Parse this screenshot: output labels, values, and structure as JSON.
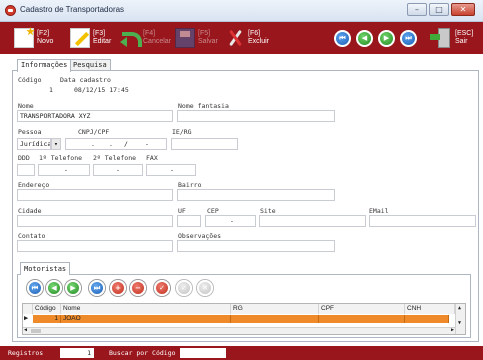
{
  "window": {
    "title": "Cadastro de Transportadoras"
  },
  "toolbar": {
    "novo": {
      "key": "[F2]",
      "label": "Novo"
    },
    "editar": {
      "key": "[F3]",
      "label": "Editar"
    },
    "cancelar": {
      "key": "[F4]",
      "label": "Cancelar"
    },
    "salvar": {
      "key": "[F5]",
      "label": "Salvar"
    },
    "excluir": {
      "key": "[F6]",
      "label": "Excluir"
    },
    "sair": {
      "key": "[ESC]",
      "label": "Sair"
    }
  },
  "tabs": [
    "Informações",
    "Pesquisa"
  ],
  "form": {
    "codigo": {
      "label": "Código",
      "value": "1"
    },
    "data_cadastro": {
      "label": "Data cadastro",
      "value": "08/12/15 17:45"
    },
    "nome": {
      "label": "Nome",
      "value": "TRANSPORTADORA XYZ"
    },
    "nome_fantasia": {
      "label": "Nome fantasia",
      "value": ""
    },
    "pessoa": {
      "label": "Pessoa",
      "value": "Jurídica"
    },
    "cnpj_cpf": {
      "label": "CNPJ/CPF",
      "value": ""
    },
    "ie_rg": {
      "label": "IE/RG",
      "value": ""
    },
    "ddd": {
      "label": "DDD",
      "value": ""
    },
    "telefone1": {
      "label": "1º Telefone",
      "value": ""
    },
    "telefone2": {
      "label": "2º Telefone",
      "value": ""
    },
    "fax": {
      "label": "FAX",
      "value": ""
    },
    "endereco": {
      "label": "Endereço",
      "value": ""
    },
    "bairro": {
      "label": "Bairro",
      "value": ""
    },
    "cidade": {
      "label": "Cidade",
      "value": ""
    },
    "uf": {
      "label": "UF",
      "value": ""
    },
    "cep": {
      "label": "CEP",
      "value": ""
    },
    "site": {
      "label": "Site",
      "value": ""
    },
    "email": {
      "label": "EMail",
      "value": ""
    },
    "contato": {
      "label": "Contato",
      "value": ""
    },
    "observacoes": {
      "label": "Observações",
      "value": ""
    }
  },
  "motoristas": {
    "title": "Motoristas",
    "columns": [
      "Código",
      "Nome",
      "RG",
      "CPF",
      "CNH"
    ],
    "rows": [
      {
        "codigo": "1",
        "nome": "JOAO",
        "rg": "",
        "cpf": "",
        "cnh": ""
      }
    ]
  },
  "statusbar": {
    "registros_label": "Registros",
    "registros_value": "1",
    "buscar_label": "Buscar por Código",
    "buscar_value": ""
  },
  "colors": {
    "toolbar": "#98161c",
    "selected_row": "#ee8a2a"
  }
}
